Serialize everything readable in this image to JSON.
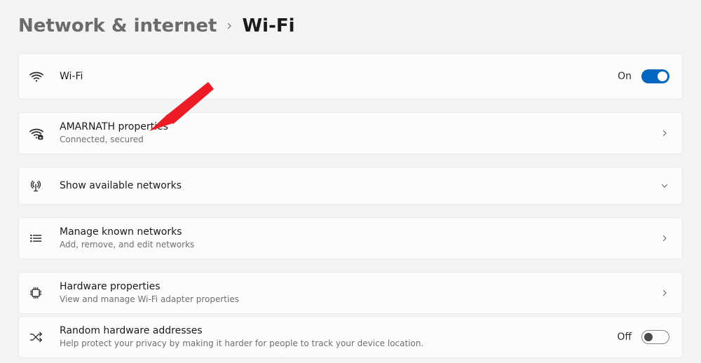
{
  "breadcrumb": {
    "parent": "Network & internet",
    "current": "Wi-Fi"
  },
  "rows": {
    "wifi": {
      "title": "Wi-Fi",
      "state": "On"
    },
    "network": {
      "title": "AMARNATH properties",
      "subtitle": "Connected, secured"
    },
    "available": {
      "title": "Show available networks"
    },
    "known": {
      "title": "Manage known networks",
      "subtitle": "Add, remove, and edit networks"
    },
    "hardware": {
      "title": "Hardware properties",
      "subtitle": "View and manage Wi-Fi adapter properties"
    },
    "random": {
      "title": "Random hardware addresses",
      "subtitle": "Help protect your privacy by making it harder for people to track your device location.",
      "state": "Off"
    }
  }
}
